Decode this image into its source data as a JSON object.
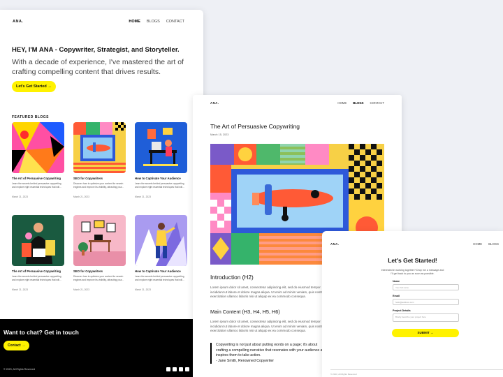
{
  "home": {
    "logo": "ANA.",
    "nav": [
      "HOME",
      "BLOGS",
      "CONTACT"
    ],
    "hero_title": "HEY, I'M ANA - Copywriter, Strategist, and Storyteller.",
    "hero_text": "With a decade of experience, I've mastered the art of crafting compelling content that drives results.",
    "cta_button": "Let's Get Started →",
    "featured_label": "FEATURED BLOGS",
    "blogs": [
      {
        "title": "The Art of Persuasive Copywriting",
        "excerpt": "Learn the secrets behind persuasive copywriting and explore eight essential techniques that will...",
        "date": "March 21, 2023"
      },
      {
        "title": "SEO for Copywriters",
        "excerpt": "Discover how to optimize your content for search engines and improve its visibility, attracting your...",
        "date": "March 21, 2023"
      },
      {
        "title": "How to Captivate Your Audience",
        "excerpt": "Learn the secrets behind persuasive copywriting and explore eight essential techniques that will...",
        "date": "March 21, 2023"
      },
      {
        "title": "The Art of Persuasive Copywriting",
        "excerpt": "Learn the secrets behind persuasive copywriting and explore eight essential techniques that will...",
        "date": "March 21, 2023"
      },
      {
        "title": "SEO for Copywriters",
        "excerpt": "Discover how to optimize your content for search engines and improve its visibility, attracting your...",
        "date": "March 21, 2023"
      },
      {
        "title": "How to Captivate Your Audience",
        "excerpt": "Learn the secrets behind persuasive copywriting and explore eight essential techniques that will...",
        "date": "March 21, 2023"
      }
    ],
    "footer_cta": "Want to chat? Get in touch",
    "contact_button": "Contact →",
    "copyright": "© 2023, All Rights Reserved"
  },
  "post": {
    "logo": "ANA.",
    "nav": [
      "HOME",
      "BLOGS",
      "CONTACT"
    ],
    "title": "The Art of Persuasive Copywriting",
    "date": "March 15, 2023",
    "h2": "Introduction (H2)",
    "p1": "Lorem ipsum dolor sit amet, consectetur adipiscing elit, sed do eiusmod tempor incididunt ut labore et dolore magna aliqua. Ut enim ad minim veniam, quis nostrud exercitation ullamco laboris nisi ut aliquip ex ea commodo consequa.",
    "h3": "Main Content (H3, H4, H5, H6)",
    "p2": "Lorem ipsum dolor sit amet, consectetur adipiscing elit, sed do eiusmod tempor incididunt ut labore et dolore magna aliqua. Ut enim ad minim veniam, quis nostrud exercitation ullamco laboris nisi ut aliquip ex ea commodo consequa.",
    "quote": "Copywriting is not just about putting words on a page; it's about crafting a compelling narrative that resonates with your audience and inspires them to take action.",
    "quote_author": "- Jane Smith, Renowned Copywriter"
  },
  "contact": {
    "logo": "ANA.",
    "nav": [
      "HOME",
      "BLOGS"
    ],
    "title": "Let's Get Started!",
    "subtitle": "Interested in working together? Drop me a message and I'll get back to you as soon as possible.",
    "name_label": "Name",
    "name_placeholder": "Your full name",
    "email_label": "Email",
    "email_placeholder": "hello@address.com",
    "details_label": "Project Details",
    "details_placeholder": "Briefly describe your project here",
    "submit": "SUBMIT →",
    "footer": "© 2023, All Rights Reserved"
  },
  "colors": {
    "accent_yellow": "#fff200",
    "footer_bg": "#000000"
  }
}
